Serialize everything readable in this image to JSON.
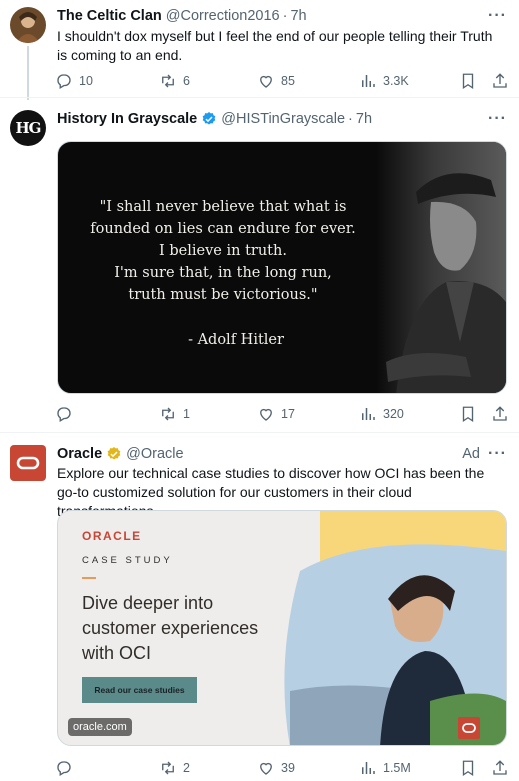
{
  "tweets": [
    {
      "name": "The Celtic Clan",
      "handle": "@Correction2016",
      "time": "7h",
      "text": "I shouldn't dox myself but I feel the end of our people telling their Truth is coming to an end.",
      "stats": {
        "replies": "10",
        "reposts": "6",
        "likes": "85",
        "views": "3.3K"
      }
    },
    {
      "name": "History In Grayscale",
      "handle": "@HISTinGrayscale",
      "time": "7h",
      "avatar_text": "HG",
      "quote_lines": [
        "\"I shall never believe that what is",
        "founded on lies can endure for ever.",
        "I believe in truth.",
        "I'm sure that, in the long run,",
        "truth must be victorious.\""
      ],
      "quote_author": "- Adolf Hitler",
      "stats": {
        "replies": "",
        "reposts": "1",
        "likes": "17",
        "views": "320"
      }
    },
    {
      "name": "Oracle",
      "handle": "@Oracle",
      "ad_label": "Ad",
      "text": "Explore our technical case studies to discover how OCI has been the go-to customized solution for our customers in their cloud transformations.",
      "card": {
        "logo": "ORACLE",
        "kicker": "CASE STUDY",
        "headline": "Dive deeper into customer experiences with OCI",
        "cta": "Read our case studies",
        "domain": "oracle.com"
      },
      "stats": {
        "replies": "",
        "reposts": "2",
        "likes": "39",
        "views": "1.5M"
      }
    }
  ],
  "colors": {
    "text": "#0f1419",
    "muted": "#536471",
    "verified": "#1d9bf0",
    "gold": "#e2b719",
    "oracle_red": "#c74634"
  },
  "icons": [
    "reply-icon",
    "repost-icon",
    "like-icon",
    "views-icon",
    "bookmark-icon",
    "share-icon",
    "more-icon",
    "verified-icon"
  ]
}
